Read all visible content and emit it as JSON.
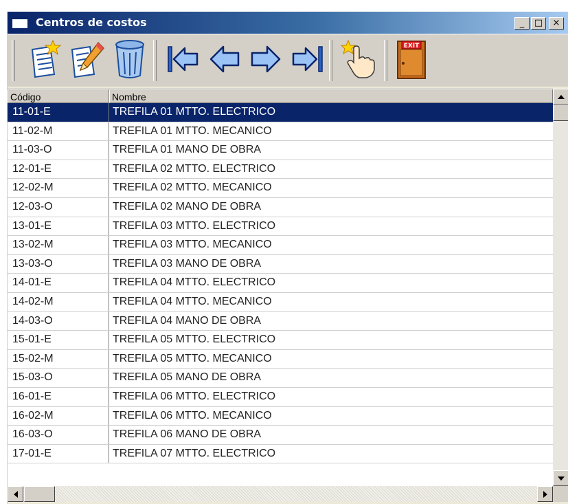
{
  "window": {
    "title": "Centros de costos",
    "controls": {
      "minimize": "_",
      "maximize": "□",
      "close": "×"
    }
  },
  "toolbar": {
    "buttons": [
      {
        "name": "new-record",
        "icon": "new-document-star-icon"
      },
      {
        "name": "edit-record",
        "icon": "edit-pencil-icon"
      },
      {
        "name": "delete-record",
        "icon": "trash-can-icon"
      },
      {
        "name": "first-record",
        "icon": "arrow-first-icon"
      },
      {
        "name": "previous-record",
        "icon": "arrow-left-icon"
      },
      {
        "name": "next-record",
        "icon": "arrow-right-icon"
      },
      {
        "name": "last-record",
        "icon": "arrow-last-icon"
      },
      {
        "name": "select-record",
        "icon": "hand-pointer-icon"
      },
      {
        "name": "exit",
        "icon": "exit-door-icon",
        "label": "EXIT"
      }
    ]
  },
  "grid": {
    "columns": [
      "Código",
      "Nombre"
    ],
    "selected_index": 0,
    "rows": [
      {
        "codigo": "11-01-E",
        "nombre": "TREFILA 01 MTTO. ELECTRICO"
      },
      {
        "codigo": "11-02-M",
        "nombre": "TREFILA 01 MTTO. MECANICO"
      },
      {
        "codigo": "11-03-O",
        "nombre": "TREFILA 01 MANO DE OBRA"
      },
      {
        "codigo": "12-01-E",
        "nombre": "TREFILA 02 MTTO. ELECTRICO"
      },
      {
        "codigo": "12-02-M",
        "nombre": "TREFILA 02 MTTO. MECANICO"
      },
      {
        "codigo": "12-03-O",
        "nombre": "TREFILA 02 MANO DE OBRA"
      },
      {
        "codigo": "13-01-E",
        "nombre": "TREFILA 03 MTTO. ELECTRICO"
      },
      {
        "codigo": "13-02-M",
        "nombre": "TREFILA 03 MTTO. MECANICO"
      },
      {
        "codigo": "13-03-O",
        "nombre": "TREFILA 03 MANO DE OBRA"
      },
      {
        "codigo": "14-01-E",
        "nombre": "TREFILA 04 MTTO. ELECTRICO"
      },
      {
        "codigo": "14-02-M",
        "nombre": "TREFILA 04 MTTO. MECANICO"
      },
      {
        "codigo": "14-03-O",
        "nombre": "TREFILA 04 MANO DE OBRA"
      },
      {
        "codigo": "15-01-E",
        "nombre": "TREFILA 05 MTTO. ELECTRICO"
      },
      {
        "codigo": "15-02-M",
        "nombre": "TREFILA 05 MTTO. MECANICO"
      },
      {
        "codigo": "15-03-O",
        "nombre": "TREFILA 05 MANO DE OBRA"
      },
      {
        "codigo": "16-01-E",
        "nombre": "TREFILA 06 MTTO. ELECTRICO"
      },
      {
        "codigo": "16-02-M",
        "nombre": "TREFILA 06 MTTO. MECANICO"
      },
      {
        "codigo": "16-03-O",
        "nombre": "TREFILA 06 MANO DE OBRA"
      },
      {
        "codigo": "17-01-E",
        "nombre": "TREFILA 07 MTTO. ELECTRICO"
      }
    ]
  },
  "colors": {
    "title_gradient_start": "#0a246a",
    "title_gradient_end": "#a6caf0",
    "selection": "#0a246a",
    "face": "#d4d0c8"
  }
}
